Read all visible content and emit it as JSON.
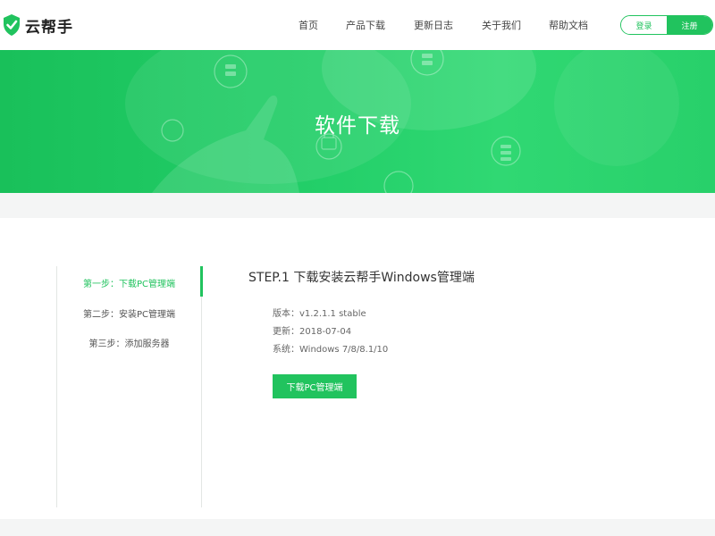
{
  "header": {
    "logo_text": "云帮手",
    "nav": [
      "首页",
      "产品下载",
      "更新日志",
      "关于我们",
      "帮助文档"
    ],
    "login_label": "登录",
    "register_label": "注册"
  },
  "banner": {
    "title": "软件下载"
  },
  "steps_nav": [
    {
      "label": "第一步：下载PC管理端",
      "active": true
    },
    {
      "label": "第二步：安装PC管理端",
      "active": false
    },
    {
      "label": "第三步：添加服务器",
      "active": false
    }
  ],
  "content": {
    "title": "STEP.1 下载安装云帮手Windows管理端",
    "version": "版本：v1.2.1.1 stable",
    "updated": "更新：2018-07-04",
    "system": "系统：Windows 7/8/8.1/10",
    "download_label": "下载PC管理端"
  },
  "colors": {
    "brand_green": "#21c35e"
  }
}
